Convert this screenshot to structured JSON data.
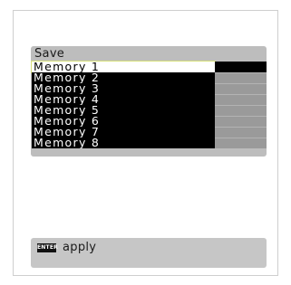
{
  "save_menu": {
    "title": "Save",
    "items": [
      {
        "label": "Memory  1",
        "selected": true
      },
      {
        "label": "Memory  2",
        "selected": false
      },
      {
        "label": "Memory  3",
        "selected": false
      },
      {
        "label": "Memory  4",
        "selected": false
      },
      {
        "label": "Memory  5",
        "selected": false
      },
      {
        "label": "Memory  6",
        "selected": false
      },
      {
        "label": "Memory  7",
        "selected": false
      },
      {
        "label": "Memory  8",
        "selected": false
      }
    ]
  },
  "footer": {
    "key_label": "ENTER",
    "key_icon": "enter-key-icon",
    "action_label": "apply"
  },
  "colors": {
    "panel": "#bdbdbd",
    "row_bg": "#000000",
    "row_text": "#ffffff",
    "selected_bg": "#ffffff",
    "selected_text": "#000000",
    "slot": "#9a9a9a"
  }
}
